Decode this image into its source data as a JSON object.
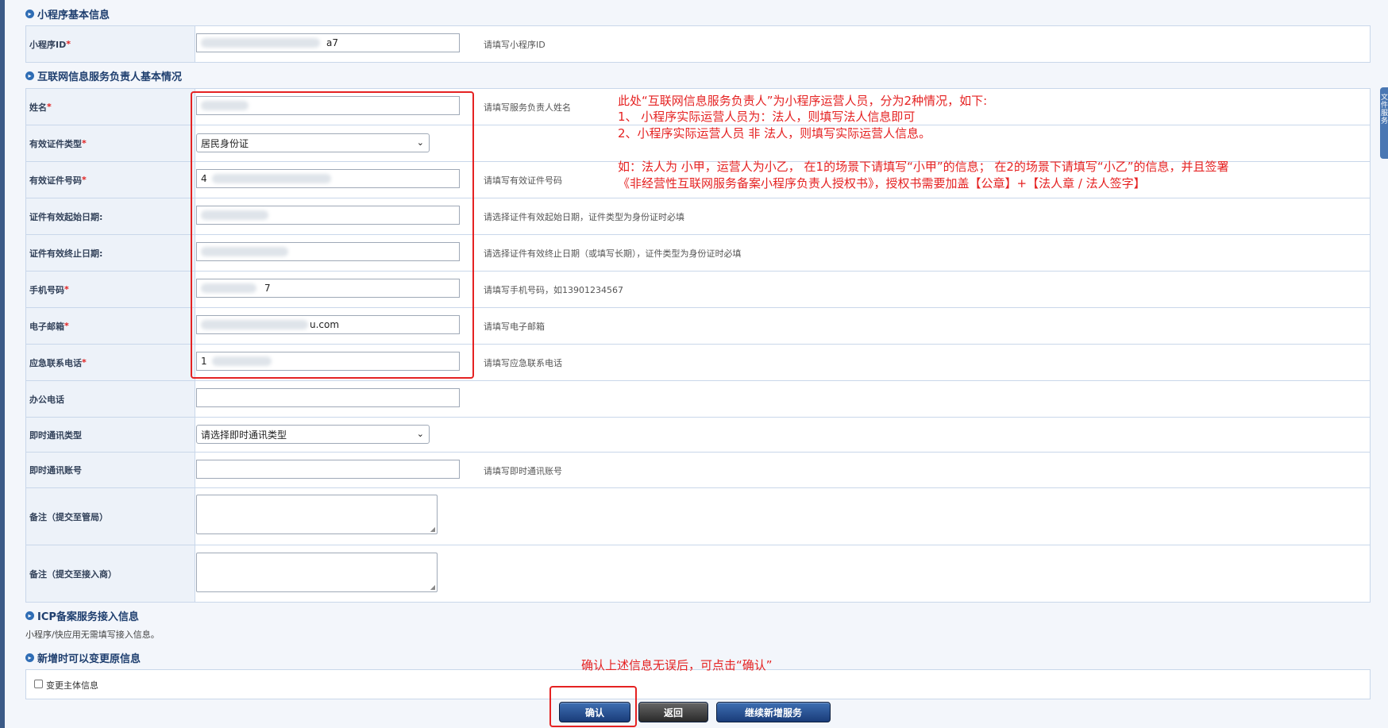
{
  "sections": {
    "mini_program_info": "小程序基本信息",
    "owner_info": "互联网信息服务负责人基本情况",
    "icp_service": "ICP备案服务接入信息",
    "icp_note": "小程序/快应用无需填写接入信息。",
    "change_info": "新增时可以变更原信息"
  },
  "mini_program": {
    "id_label": "小程序ID",
    "id_value_suffix": "a7",
    "id_hint": "请填写小程序ID"
  },
  "required_mark": "*",
  "fields": {
    "name_label": "姓名",
    "name_hint": "请填写服务负责人姓名",
    "id_type_label": "有效证件类型",
    "id_type_value": "居民身份证",
    "id_number_label": "有效证件号码",
    "id_number_prefix": "4",
    "id_number_hint": "请填写有效证件号码",
    "start_date_label": "证件有效起始日期:",
    "start_date_hint": "请选择证件有效起始日期，证件类型为身份证时必填",
    "end_date_label": "证件有效终止日期:",
    "end_date_hint": "请选择证件有效终止日期（或填写长期），证件类型为身份证时必填",
    "mobile_label": "手机号码",
    "mobile_suffix": "7",
    "mobile_hint": "请填写手机号码，如13901234567",
    "email_label": "电子邮箱",
    "email_suffix": "u.com",
    "email_hint": "请填写电子邮箱",
    "emergency_label": "应急联系电话",
    "emergency_prefix": "1",
    "emergency_hint": "请填写应急联系电话",
    "office_label": "办公电话",
    "im_type_label": "即时通讯类型",
    "im_type_value": "请选择即时通讯类型",
    "im_account_label": "即时通讯账号",
    "im_account_hint": "请填写即时通讯账号",
    "remark_bureau_label": "备注（提交至管局）",
    "remark_access_label": "备注（提交至接入商）"
  },
  "annotations": {
    "line1": "此处“互联网信息服务负责人”为小程序运营人员，分为2种情况，如下:",
    "line2": "1、 小程序实际运营人员为：法人，则填写法人信息即可",
    "line3": "2、小程序实际运营人员 非 法人，则填写实际运营人信息。",
    "line4": "如：法人为 小甲，运营人为小乙， 在1的场景下请填写“小甲”的信息； 在2的场景下请填写“小乙”的信息，并且签署",
    "line5": "《非经营性互联网服务备案小程序负责人授权书》，授权书需要加盖【公章】+【法人章 / 法人签字】",
    "confirm_tip": "确认上述信息无误后，可点击“确认”"
  },
  "change_subject_label": "变更主体信息",
  "buttons": {
    "confirm": "确认",
    "back": "返回",
    "continue": "继续新增服务"
  },
  "side_tab_text": "文件服务",
  "colors": {
    "annotation": "#e52222",
    "section_title": "#1f3f6f",
    "button_blue": "#1a3c79"
  }
}
